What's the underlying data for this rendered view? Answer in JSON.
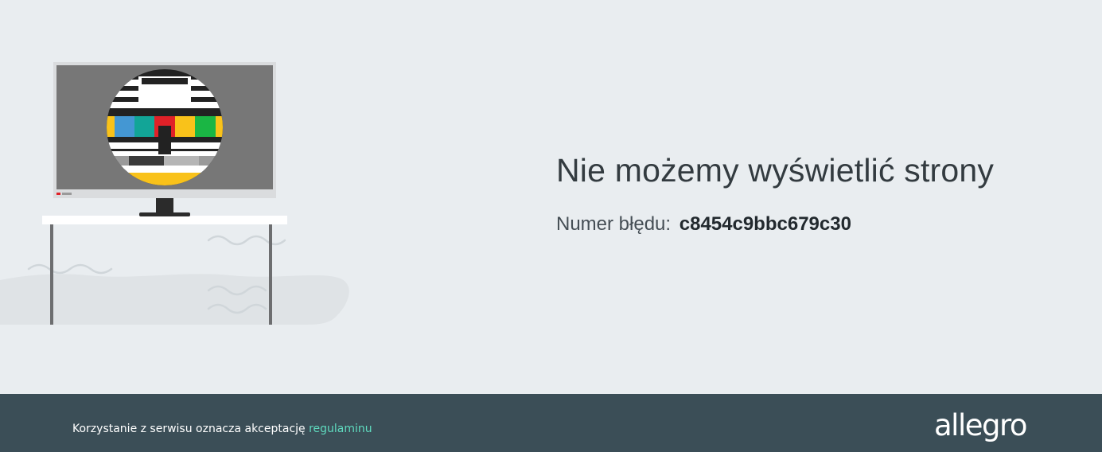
{
  "error": {
    "title": "Nie możemy wyświetlić strony",
    "code_label": "Numer błędu:",
    "code": "c8454c9bbc679c30"
  },
  "footer": {
    "text": "Korzystanie z serwisu oznacza akceptację",
    "link_label": "regulaminu",
    "logo_text": "allegro"
  },
  "colors": {
    "page_background": "#e9edf0",
    "footer_background": "#3b4e57",
    "link": "#5fdbbf",
    "test_pattern": [
      "#4497d3",
      "#12a597",
      "#e02128",
      "#f9c21a",
      "#1ab644"
    ]
  },
  "icons": {
    "illustration": "broken-tv-test-pattern-illustration"
  }
}
